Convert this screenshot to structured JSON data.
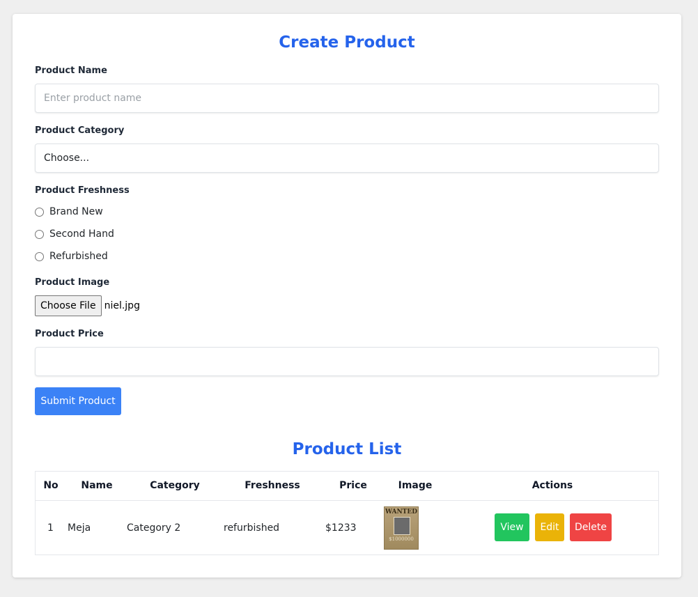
{
  "form": {
    "title": "Create Product",
    "name_label": "Product Name",
    "name_placeholder": "Enter product name",
    "category_label": "Product Category",
    "category_selected": "Choose...",
    "freshness_label": "Product Freshness",
    "freshness_options": [
      "Brand New",
      "Second Hand",
      "Refurbished"
    ],
    "image_label": "Product Image",
    "file_button": "Choose File",
    "file_name": "niel.jpg",
    "price_label": "Product Price",
    "price_value": "",
    "submit_label": "Submit Product"
  },
  "list": {
    "title": "Product List",
    "columns": [
      "No",
      "Name",
      "Category",
      "Freshness",
      "Price",
      "Image",
      "Actions"
    ],
    "rows": [
      {
        "no": "1",
        "name": "Meja",
        "category": "Category 2",
        "freshness": "refurbished",
        "price": "$1233",
        "image_text": "WANTED",
        "image_subtext": "$1000000",
        "actions": [
          "View",
          "Edit",
          "Delete"
        ]
      }
    ]
  },
  "colors": {
    "accent": "#2563eb",
    "submit": "#3b82f6",
    "view": "#22c55e",
    "edit": "#eab308",
    "delete": "#ef4444"
  }
}
